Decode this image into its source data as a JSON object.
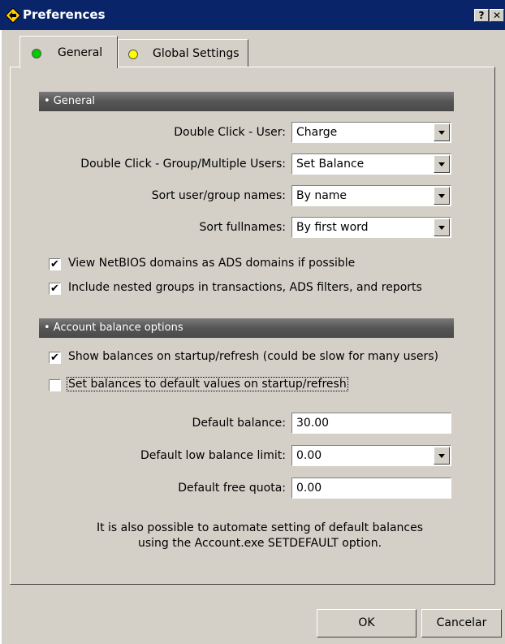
{
  "window": {
    "title": "Preferences",
    "help_label": "?",
    "close_label": "✕"
  },
  "tabs": [
    {
      "label": "General",
      "dot_color": "#00cc00"
    },
    {
      "label": "Global Settings",
      "dot_color": "#ffff00"
    }
  ],
  "general": {
    "header": "• General",
    "rows": [
      {
        "label": "Double Click - User:",
        "value": "Charge"
      },
      {
        "label": "Double Click - Group/Multiple Users:",
        "value": "Set Balance"
      },
      {
        "label": "Sort user/group names:",
        "value": "By name"
      },
      {
        "label": "Sort fullnames:",
        "value": "By first word"
      }
    ],
    "checkboxes": [
      {
        "label": "View NetBIOS domains as ADS domains if possible",
        "checked": true,
        "mark": "✔"
      },
      {
        "label": "Include nested groups in transactions, ADS filters, and reports",
        "checked": true,
        "mark": "✔"
      }
    ]
  },
  "balance": {
    "header": "• Account balance options",
    "checkboxes": [
      {
        "label": "Show balances on startup/refresh (could be slow for many users)",
        "checked": true,
        "mark": "✔"
      },
      {
        "label": "Set balances to default values on startup/refresh",
        "checked": false,
        "mark": ""
      }
    ],
    "default_balance": {
      "label": "Default balance:",
      "value": "30.00"
    },
    "low_limit": {
      "label": "Default low balance limit:",
      "value": "0.00"
    },
    "free_quota": {
      "label": "Default free quota:",
      "value": "0.00"
    },
    "note_line1": "It is also possible to automate setting of default balances",
    "note_line2": "using the Account.exe SETDEFAULT option."
  },
  "buttons": {
    "ok": "OK",
    "cancel": "Cancelar"
  }
}
